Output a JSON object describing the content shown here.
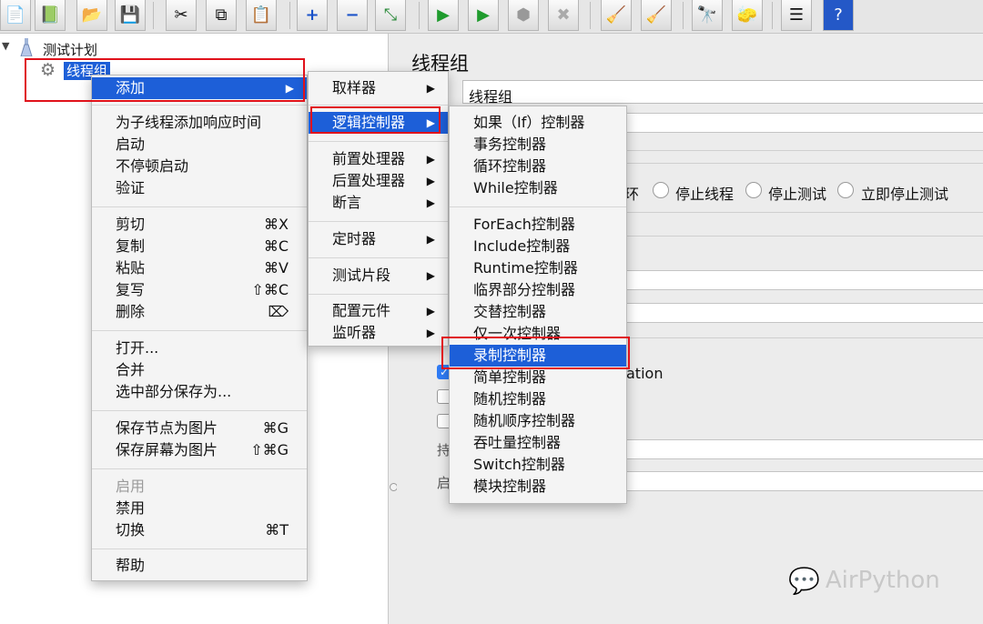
{
  "toolbar": {
    "icons": [
      "new-icon",
      "templates-icon",
      "open-icon",
      "save-icon",
      "cut-icon",
      "copy-icon",
      "paste-icon",
      "expand-icon",
      "collapse-icon",
      "toggle-icon",
      "start-icon",
      "start-no-pause-icon",
      "stop-icon",
      "shutdown-icon",
      "clear-icon",
      "clear-all-icon",
      "search-icon",
      "reset-search-icon",
      "function-helper-icon",
      "help-icon"
    ]
  },
  "tree": {
    "plan_label": "测试计划",
    "thread_group_label": "线程组"
  },
  "main": {
    "title": "线程组",
    "name_value": "线程组",
    "radio_partial": "环",
    "radios": [
      "停止线程",
      "停止测试",
      "立即停止测试"
    ],
    "checkbox_partial": "ation",
    "label_a": "持",
    "label_b": "启"
  },
  "context_menu": {
    "add": "添加",
    "group1": [
      "为子线程添加响应时间",
      "启动",
      "不停顿启动",
      "验证"
    ],
    "group2": [
      {
        "label": "剪切",
        "shortcut": "⌘X"
      },
      {
        "label": "复制",
        "shortcut": "⌘C"
      },
      {
        "label": "粘贴",
        "shortcut": "⌘V"
      },
      {
        "label": "复写",
        "shortcut": "⇧⌘C"
      },
      {
        "label": "删除",
        "shortcut": "⌦"
      }
    ],
    "group3": [
      "打开...",
      "合并",
      "选中部分保存为..."
    ],
    "group4": [
      {
        "label": "保存节点为图片",
        "shortcut": "⌘G"
      },
      {
        "label": "保存屏幕为图片",
        "shortcut": "⇧⌘G"
      }
    ],
    "group5": [
      {
        "label": "启用",
        "shortcut": ""
      },
      {
        "label": "禁用",
        "shortcut": ""
      },
      {
        "label": "切换",
        "shortcut": "⌘T"
      }
    ],
    "help": "帮助"
  },
  "add_menu": {
    "sampler": "取样器",
    "logic_controller": "逻辑控制器",
    "pre_processor": "前置处理器",
    "post_processor": "后置处理器",
    "assertion": "断言",
    "timer": "定时器",
    "test_fragment": "测试片段",
    "config_element": "配置元件",
    "listener": "监听器"
  },
  "logic_menu": {
    "items": [
      "如果（If）控制器",
      "事务控制器",
      "循环控制器",
      "While控制器",
      "ForEach控制器",
      "Include控制器",
      "Runtime控制器",
      "临界部分控制器",
      "交替控制器",
      "仅一次控制器",
      "录制控制器",
      "简单控制器",
      "随机控制器",
      "随机顺序控制器",
      "吞吐量控制器",
      "Switch控制器",
      "模块控制器"
    ],
    "highlighted": "录制控制器"
  },
  "watermark": "AirPython",
  "colors": {
    "highlight": "#1d5fd8",
    "annotation_red": "#e0121b"
  }
}
